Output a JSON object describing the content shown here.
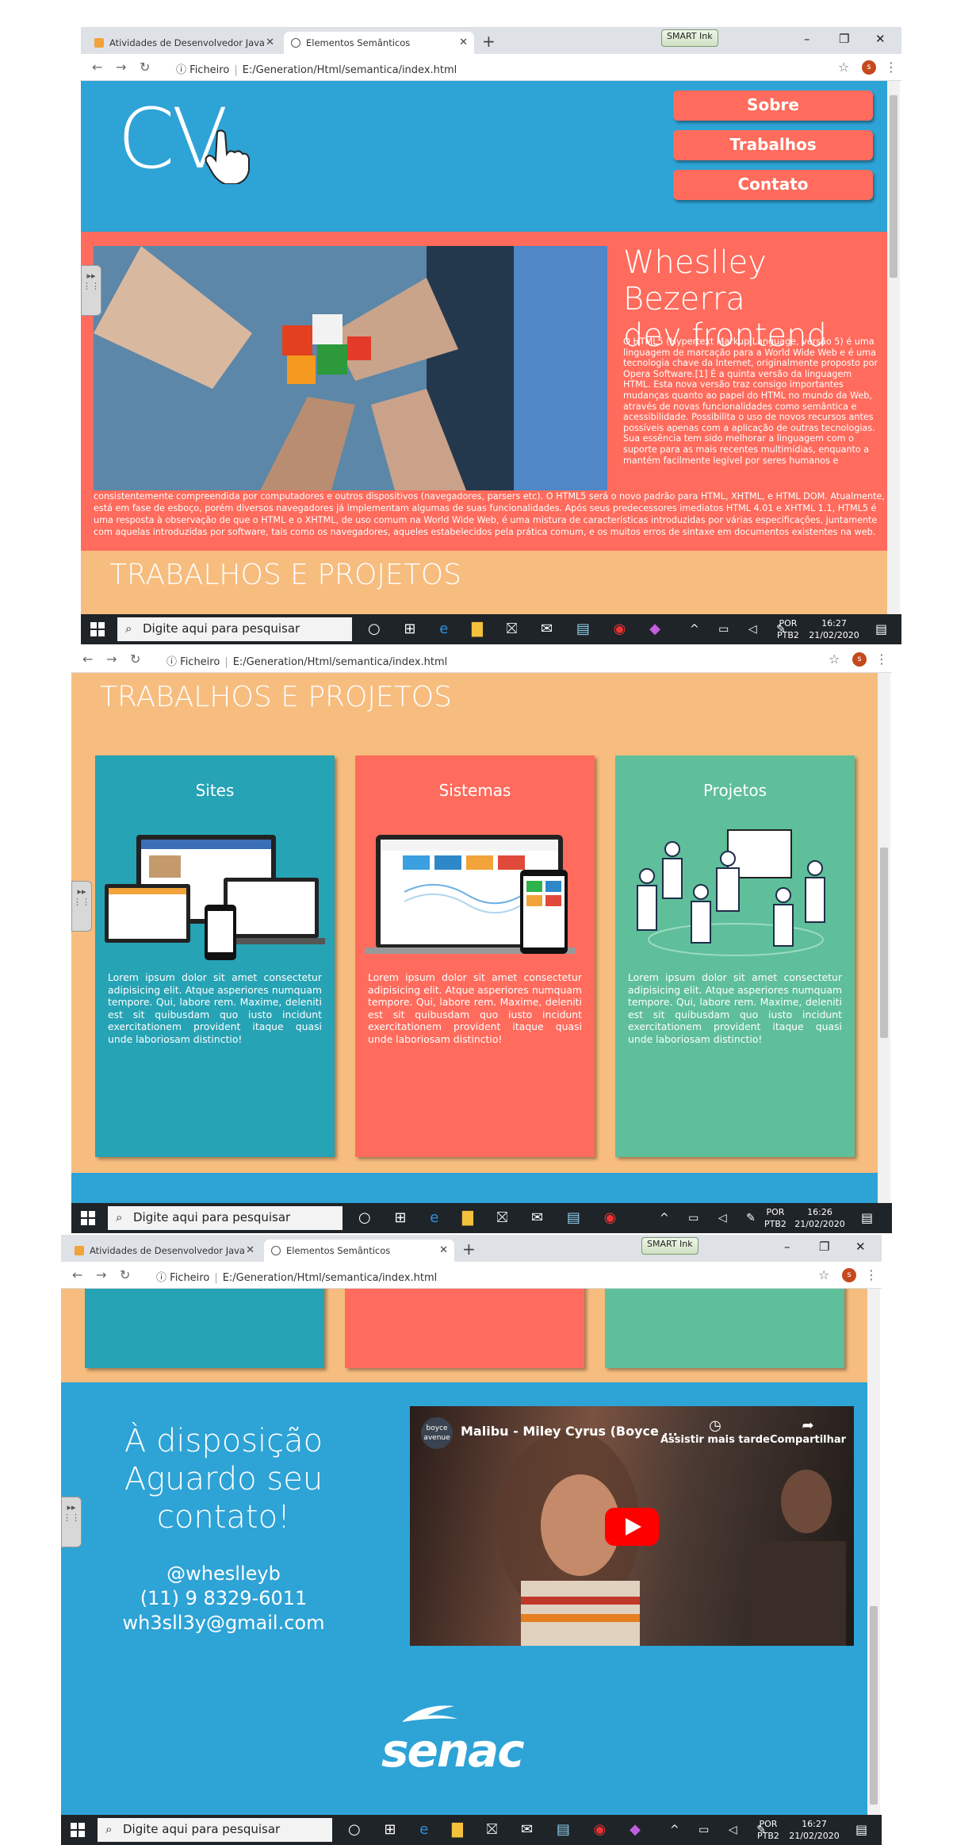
{
  "browser": {
    "tabs": [
      {
        "label": "Atividades de Desenvolvedor Java",
        "icon": "classroom-icon",
        "color": "#f2a33a"
      },
      {
        "label": "Elementos Semânticos",
        "icon": "globe-icon"
      }
    ],
    "smart_ink": "SMART Ink",
    "address_prefix": "Ficheiro",
    "address": "E:/Generation/Html/semantica/index.html",
    "profile_initial": "s"
  },
  "taskbar": {
    "search_placeholder": "Digite aqui para pesquisar",
    "lang_line1": "POR",
    "lang_line2": "PTB2",
    "date": "21/02/2020",
    "times": [
      "16:27",
      "16:26",
      "16:27"
    ]
  },
  "site": {
    "colors": {
      "blue": "#2ea3d6",
      "coral": "#ff6b5c",
      "peach": "#f7bd7f",
      "teal": "#26a3b5",
      "green": "#5ebf9a"
    },
    "logo": "CV",
    "nav": [
      {
        "label": "Sobre"
      },
      {
        "label": "Trabalhos"
      },
      {
        "label": "Contato"
      }
    ],
    "hero": {
      "title_line1": "Wheslley Bezerra",
      "title_line2": "dev frontend",
      "text_right": "O HTML5 (Hypertext Markup Language, versão 5) é uma linguagem de marcação para a World Wide Web e é uma tecnologia chave da Internet, originalmente proposto por Opera Software.[1] É a quinta versão da linguagem HTML. Esta nova versão traz consigo importantes mudanças quanto ao papel do HTML no mundo da Web, através de novas funcionalidades como semântica e acessibilidade. Possibilita o uso de novos recursos antes possíveis apenas com a aplicação de outras tecnologias. Sua essência tem sido melhorar a linguagem com o suporte para as mais recentes multimídias, enquanto a mantém facilmente legível por seres humanos e",
      "text_bottom": "consistentemente compreendida por computadores e outros dispositivos (navegadores, parsers etc). O HTML5 será o novo padrão para HTML, XHTML, e HTML DOM. Atualmente, está em fase de esboço, porém diversos navegadores já implementam algumas de suas funcionalidades. Após seus predecessores imediatos HTML 4.01 e XHTML 1.1, HTML5 é uma resposta à observação de que o HTML e o XHTML, de uso comum na World Wide Web, é uma mistura de características introduzidas por várias especificações, juntamente com aquelas introduzidas por software, tais como os navegadores, aqueles estabelecidos pela prática comum, e os muitos erros de sintaxe em documentos existentes na web."
    },
    "trabalhos_title": "TRABALHOS E PROJETOS",
    "cards": [
      {
        "title": "Sites",
        "color": "#26a3b5",
        "image": "responsive-devices-image",
        "text": "Lorem ipsum dolor sit amet consectetur adipisicing elit. Atque asperiores numquam tempore. Qui, labore rem. Maxime, deleniti est sit quibusdam quo iusto incidunt exercitationem provident itaque quasi unde laboriosam distinctio!"
      },
      {
        "title": "Sistemas",
        "color": "#ff6b5c",
        "image": "dashboard-devices-image",
        "text": "Lorem ipsum dolor sit amet consectetur adipisicing elit. Atque asperiores numquam tempore. Qui, labore rem. Maxime, deleniti est sit quibusdam quo iusto incidunt exercitationem provident itaque quasi unde laboriosam distinctio!"
      },
      {
        "title": "Projetos",
        "color": "#5ebf9a",
        "image": "team-meeting-image",
        "text": "Lorem ipsum dolor sit amet consectetur adipisicing elit. Atque asperiores numquam tempore. Qui, labore rem. Maxime, deleniti est sit quibusdam quo iusto incidunt exercitationem provident itaque quasi unde laboriosam distinctio!"
      }
    ],
    "contato": {
      "heading_line1": "À disposição",
      "heading_line2": "Aguardo seu",
      "heading_line3": "contato!",
      "handle": "@wheslleyb",
      "phone": "(11) 9 8329-6011",
      "email": "wh3sll3y@gmail.com"
    },
    "video": {
      "title": "Malibu - Miley Cyrus (Boyce ...",
      "channel": "boyce avenue",
      "watch_later": "Assistir mais tarde",
      "share": "Compartilhar"
    },
    "footer_logo": "senac"
  }
}
